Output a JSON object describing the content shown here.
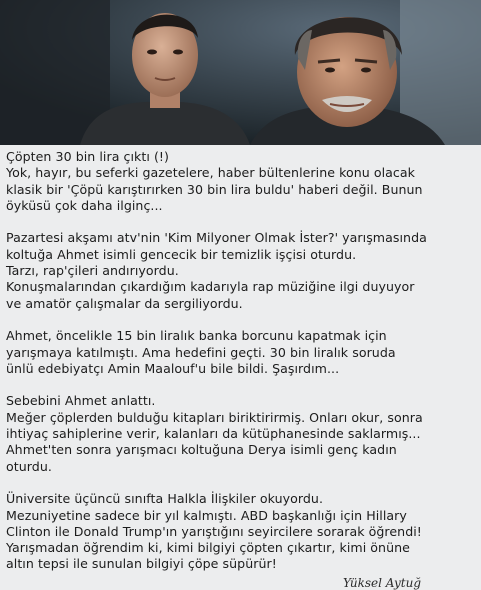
{
  "photo": {
    "description_icon": "photo-of-two-men"
  },
  "article": {
    "paragraphs": [
      [
        "Çöpten 30 bin lira çıktı (!)",
        "Yok, hayır, bu seferki gazetelere, haber bültenlerine konu olacak",
        "klasik bir 'Çöpü karıştırırken 30 bin lira buldu' haberi değil. Bunun",
        "öyküsü çok daha ilginç..."
      ],
      [
        "Pazartesi akşamı atv'nin 'Kim Milyoner Olmak İster?' yarışmasında",
        "koltuğa Ahmet isimli gencecik bir temizlik işçisi oturdu.",
        "Tarzı, rap'çileri andırıyordu.",
        "Konuşmalarından çıkardığım kadarıyla rap müziğine ilgi duyuyor",
        "ve amatör çalışmalar da sergiliyordu."
      ],
      [
        "Ahmet, öncelikle 15 bin liralık banka borcunu kapatmak için",
        "yarışmaya katılmıştı. Ama hedefini geçti. 30 bin liralık soruda",
        "ünlü edebiyatçı Amin Maalouf'u bile bildi. Şaşırdım..."
      ],
      [
        "Sebebini Ahmet anlattı.",
        "Meğer çöplerden bulduğu kitapları biriktirirmiş. Onları okur, sonra",
        "ihtiyaç sahiplerine verir, kalanları da kütüphanesinde saklarmış...",
        "Ahmet'ten sonra yarışmacı koltuğuna Derya isimli genç kadın",
        "oturdu."
      ],
      [
        "Üniversite üçüncü sınıfta Halkla İlişkiler okuyordu.",
        "Mezuniyetine sadece bir yıl kalmıştı. ABD başkanlığı için Hillary",
        "Clinton ile Donald Trump'ın yarıştığını seyircilere sorarak öğrendi!",
        "Yarışmadan öğrendim ki, kimi bilgiyi çöpten çıkartır, kimi önüne",
        "altın tepsi ile sunulan bilgiyi çöpe süpürür!"
      ]
    ],
    "signature": "Yüksel Aytuğ"
  }
}
